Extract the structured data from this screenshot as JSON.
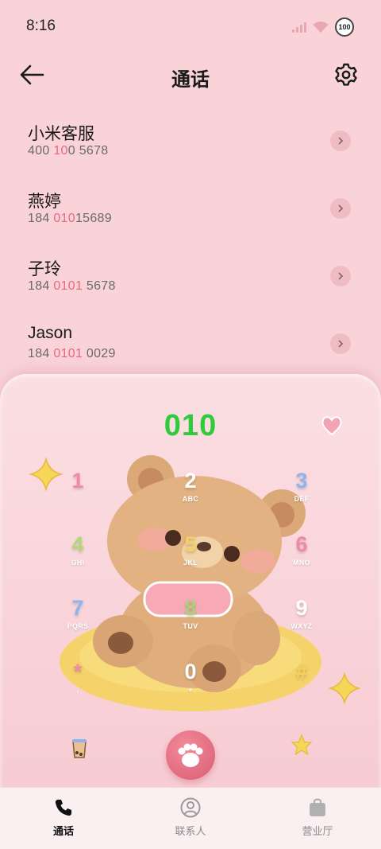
{
  "status_bar": {
    "time": "8:16",
    "battery": "100"
  },
  "header": {
    "title": "通话"
  },
  "contacts": [
    {
      "name": "小米客服",
      "number_parts": [
        "400 ",
        "10",
        "0 5678"
      ]
    },
    {
      "name": "燕婷",
      "number_parts": [
        "184 ",
        "010",
        "15689"
      ]
    },
    {
      "name": "子玲",
      "number_parts": [
        "184 ",
        "0101",
        " 5678"
      ]
    },
    {
      "name": "Jason",
      "number_parts": [
        "184 ",
        "0101",
        " 0029"
      ]
    }
  ],
  "dialpad": {
    "display": "010",
    "keys": [
      {
        "digit": "1",
        "letters": "",
        "color": "#f08aa0"
      },
      {
        "digit": "2",
        "letters": "ABC",
        "color": "#ffffff"
      },
      {
        "digit": "3",
        "letters": "DEF",
        "color": "#8fb3f0"
      },
      {
        "digit": "4",
        "letters": "GHI",
        "color": "#b5d77a"
      },
      {
        "digit": "5",
        "letters": "JKL",
        "color": "#f6cf62"
      },
      {
        "digit": "6",
        "letters": "MNO",
        "color": "#f08aa0"
      },
      {
        "digit": "7",
        "letters": "PQRS",
        "color": "#8fb3f0"
      },
      {
        "digit": "8",
        "letters": "TUV",
        "color": "#a8d27a"
      },
      {
        "digit": "9",
        "letters": "WXYZ",
        "color": "#ffffff"
      },
      {
        "digit": "*",
        "letters": ",",
        "color": "#f08aa0"
      },
      {
        "digit": "0",
        "letters": "+",
        "color": "#ffffff"
      },
      {
        "digit": "#",
        "letters": "",
        "color": "#f6cf62"
      }
    ]
  },
  "bottom_nav": [
    {
      "label": "通话",
      "icon": "phone-icon",
      "active": true
    },
    {
      "label": "联系人",
      "icon": "contacts-icon",
      "active": false
    },
    {
      "label": "营业厅",
      "icon": "store-icon",
      "active": false
    }
  ]
}
